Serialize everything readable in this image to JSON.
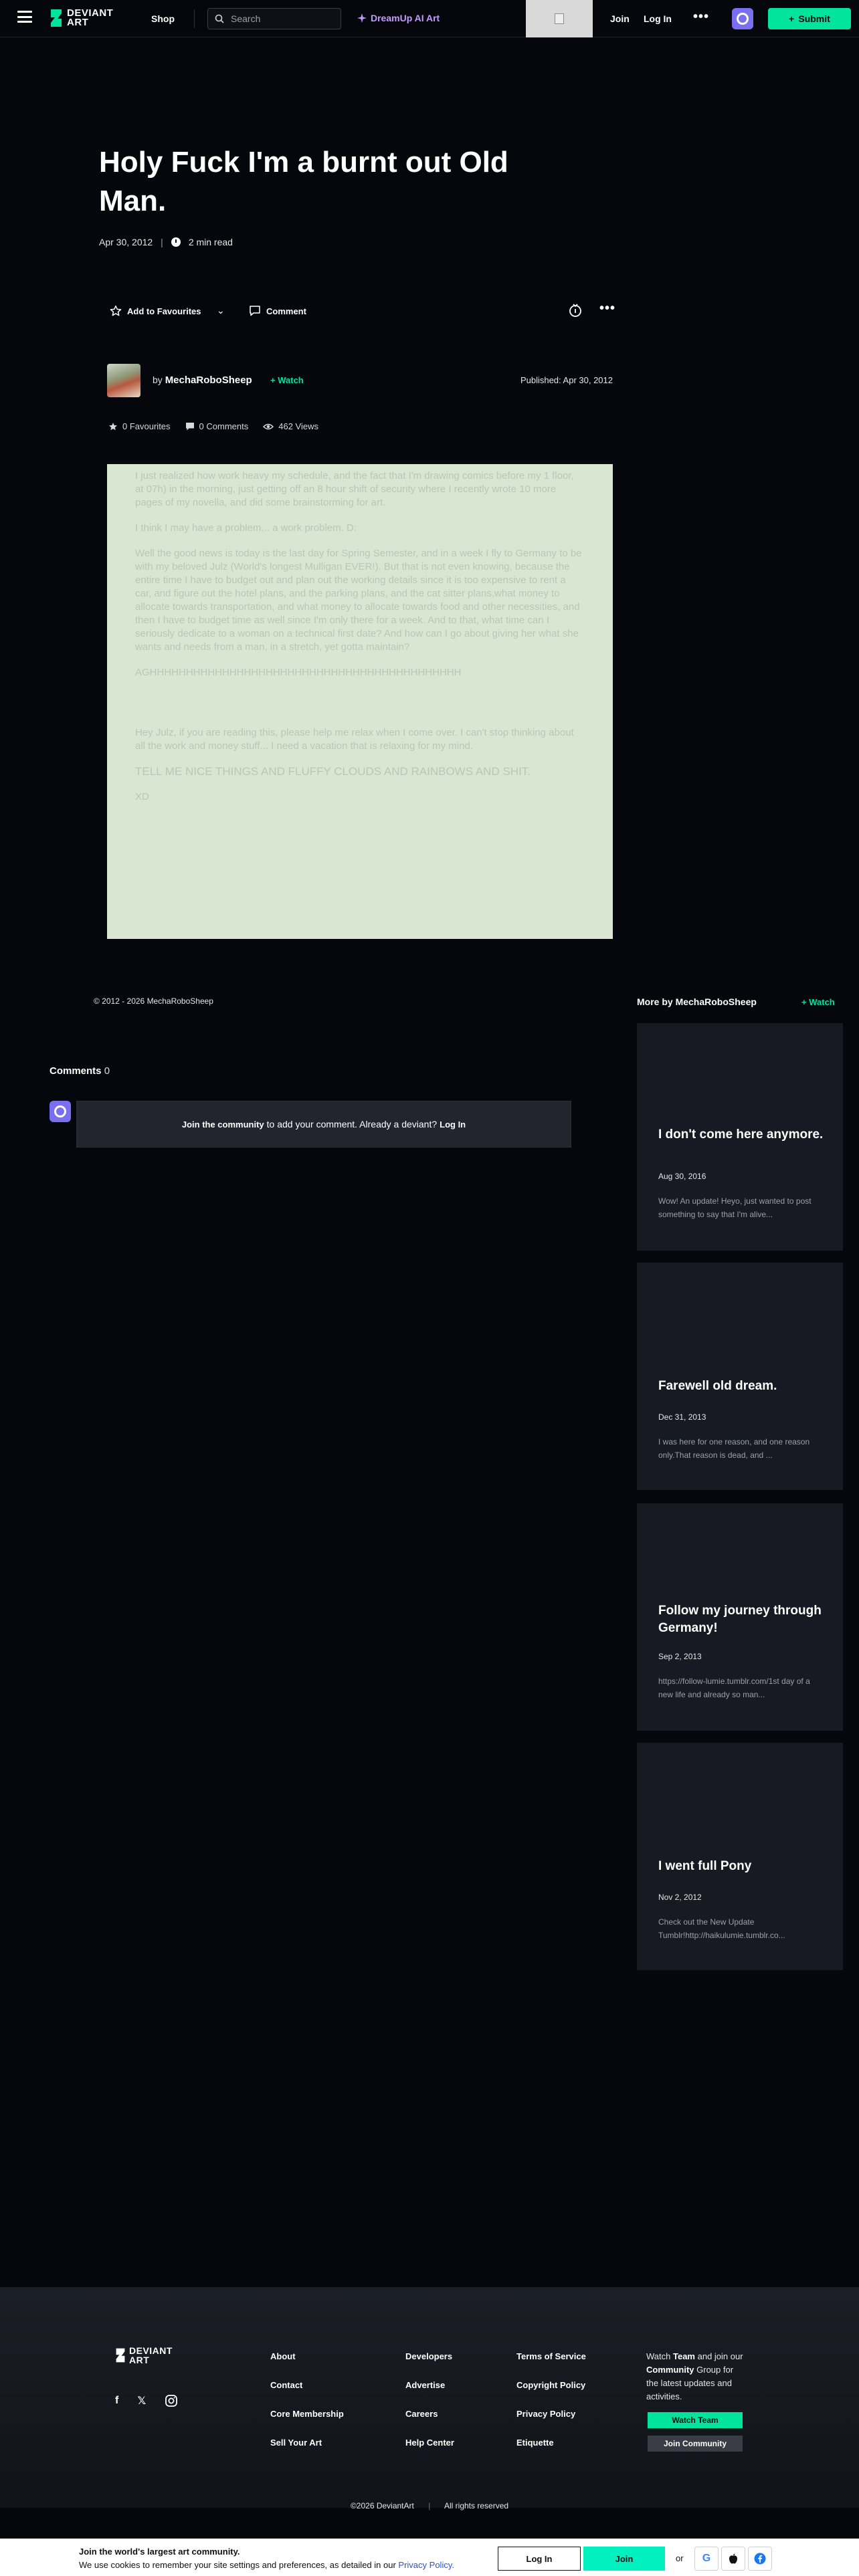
{
  "header": {
    "shop": "Shop",
    "search_placeholder": "Search",
    "dreamup": "DreamUp AI Art",
    "join": "Join",
    "login": "Log In",
    "more": "•••",
    "submit": "Submit",
    "logo_text": "DEVIANT ART"
  },
  "article": {
    "title": "Holy Fuck I'm a burnt out Old Man.",
    "date": "Apr 30, 2012",
    "read_time": "2 min read",
    "add_to_favourites": "Add to Favourites",
    "comment": "Comment",
    "author_by": "by",
    "author": "MechaRoboSheep",
    "watch": "Watch",
    "published": "Published: Apr 30, 2012",
    "favourites": "0 Favourites",
    "comments_count": "0 Comments",
    "views": "462 Views",
    "paragraphs": [
      "I just realized how work heavy my schedule, and the fact that I'm drawing comics before my 1 floor, at 07h) in the morning, just getting off an 8 hour shift of security where I recently wrote 10 more pages of my novella, and did some brainstorming for art.",
      "I think I may have a problem... a work problem. D:",
      "Well the good news is today is the last day for Spring Semester, and in a week I fly to Germany to be with my beloved Julz (World's longest Mulligan EVER!). But that is not even knowing, because the entire time I have to budget out and plan out the working details since it is too expensive to rent a car, and figure out the hotel plans, and the parking plans, and the cat sitter plans,what money to allocate towards transportation, and what money to allocate towards food and other necessities, and then I have to budget time as well since I'm only there for a week. And to that, what time can I seriously dedicate to a woman on a technical first date? And how can I go about giving her what she wants and needs from a man, in a stretch, yet gotta maintain?",
      "AGHHHHHHHHHHHHHHHHHHHHHHHHHHHHHHHHHHHHHHHHHHH",
      "Hey Julz, if you are reading this, please help me relax when I come over. I can't stop thinking about all the work and money stuff... I need a vacation that is relaxing for my mind.",
      "TELL ME NICE THINGS AND FLUFFY CLOUDS AND RAINBOWS AND SHIT.",
      "XD"
    ],
    "copyright": "© 2012 - 2026 MechaRoboSheep"
  },
  "comments": {
    "heading": "Comments",
    "count": "0",
    "join_link": "Join the community",
    "join_text": "to add your comment. Already a deviant?",
    "login_link": "Log In"
  },
  "sidebar": {
    "heading": "More by MechaRoboSheep",
    "watch": "Watch",
    "cards": [
      {
        "title": "I don't come here anymore.",
        "date": "Aug 30, 2016",
        "excerpt": "Wow! An update! Heyo, just wanted to post something to say that I'm alive..."
      },
      {
        "title": "Farewell old dream.",
        "date": "Dec 31, 2013",
        "excerpt": "I was here for one reason, and one reason only.That reason is dead, and ..."
      },
      {
        "title": "Follow my journey through Germany!",
        "date": "Sep 2, 2013",
        "excerpt": "https://follow-lumie.tumblr.com/1st day of a new life and already so  man..."
      },
      {
        "title": "I went full Pony",
        "date": "Nov 2, 2012",
        "excerpt": "Check out the New Update Tumblr!http://haikulumie.tumblr.co..."
      }
    ]
  },
  "footer": {
    "col1": [
      "About",
      "Contact",
      "Core Membership",
      "Sell Your Art"
    ],
    "col2": [
      "Developers",
      "Advertise",
      "Careers",
      "Help Center"
    ],
    "col3": [
      "Terms of Service",
      "Copyright Policy",
      "Privacy Policy",
      "Etiquette"
    ],
    "watch_pre": "Watch",
    "watch_team": "Team",
    "watch_mid": "and join our",
    "watch_community": "Community",
    "watch_post": "Group for the latest updates and activities.",
    "watch_team_btn": "Watch Team",
    "join_community_btn": "Join Community",
    "copyright": "©2026 DeviantArt",
    "rights": "All rights reserved"
  },
  "cookie": {
    "headline": "Join the world's largest art community.",
    "text": "We use cookies to remember your site settings and preferences, as detailed in our",
    "policy_link": "Privacy Policy.",
    "login": "Log In",
    "join": "Join",
    "or": "or"
  },
  "colors": {
    "background": "#06070d",
    "accent_green": "#00e59b",
    "dreamup_purple": "#c29bff",
    "article_panel": "#d8e6d2",
    "card_bg": "#171a22"
  },
  "icons": [
    "menu-icon",
    "search-icon",
    "sparkle-icon",
    "star-icon",
    "chevron-down-icon",
    "comment-icon",
    "badge-icon",
    "clock-icon",
    "eye-icon",
    "facebook-icon",
    "x-icon",
    "instagram-icon",
    "google-icon",
    "apple-icon"
  ]
}
